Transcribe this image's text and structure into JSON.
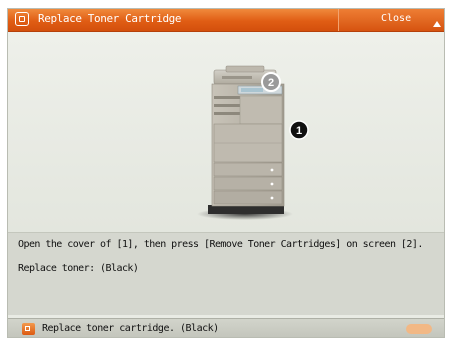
{
  "dialog": {
    "title": "Replace Toner Cartridge",
    "close_label": "Close",
    "accent_color": "#e05d14"
  },
  "illustration": {
    "callout_1": "1",
    "callout_2": "2",
    "subject": "printer-copier"
  },
  "message": {
    "instruction": "Open the cover of [1], then press [Remove Toner Cartridges] on screen [2].",
    "toner": "Replace toner: (Black)"
  },
  "status_bar": {
    "text": "Replace toner cartridge. (Black)",
    "icon": "alert-icon"
  }
}
